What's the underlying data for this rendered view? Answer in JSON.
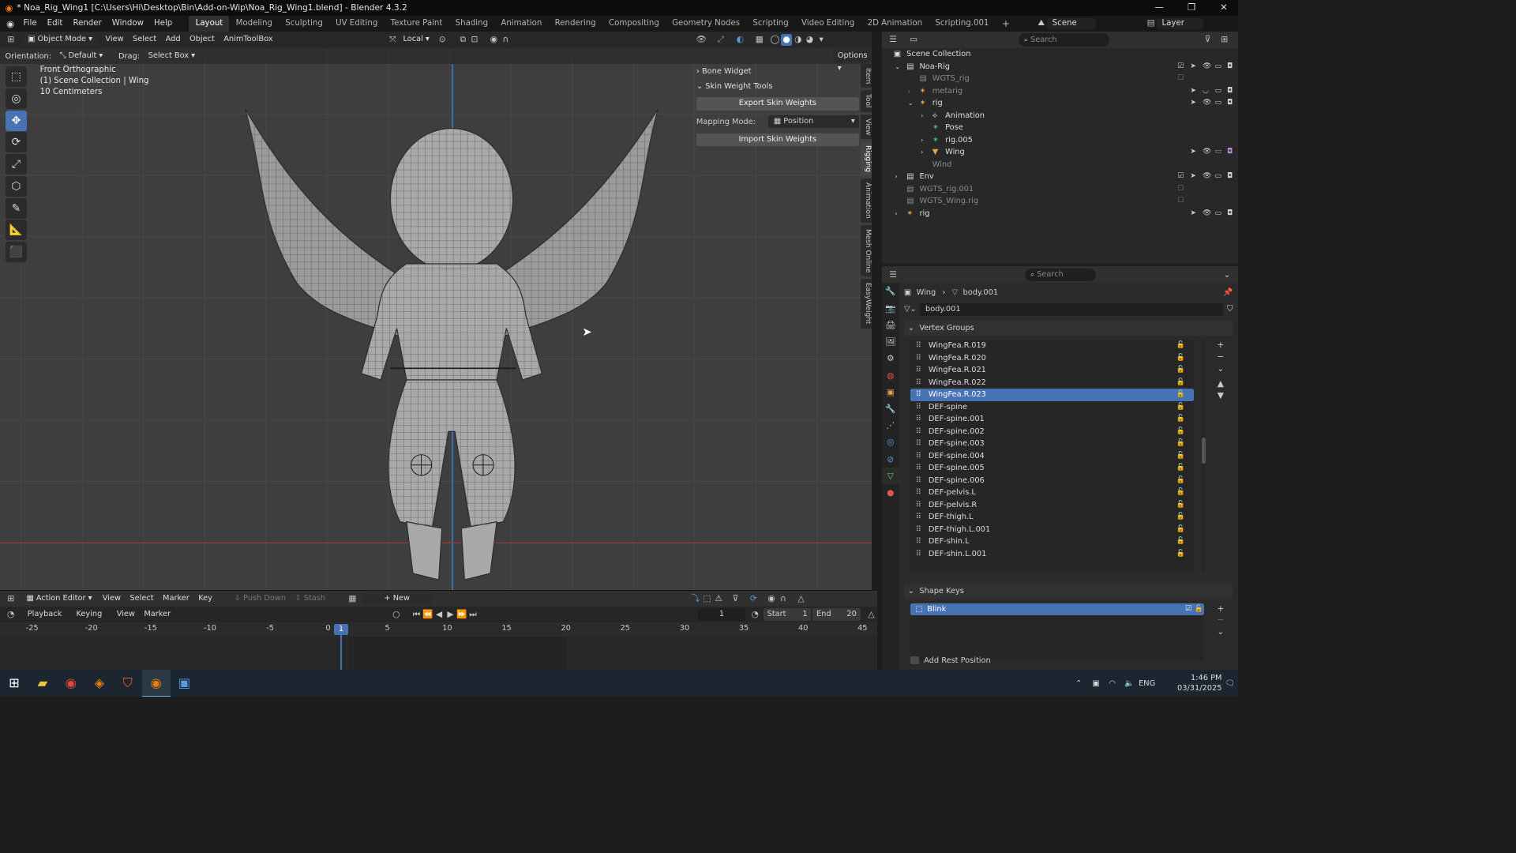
{
  "titlebar": {
    "title": "* Noa_Rig_Wing1 [C:\\Users\\Hi\\Desktop\\Bin\\Add-on-Wip\\Noa_Rig_Wing1.blend] - Blender 4.3.2",
    "minimize": "—",
    "maximize": "❐",
    "close": "✕"
  },
  "menu": {
    "items": [
      "File",
      "Edit",
      "Render",
      "Window",
      "Help"
    ],
    "workspaces": [
      "Layout",
      "Modeling",
      "Sculpting",
      "UV Editing",
      "Texture Paint",
      "Shading",
      "Animation",
      "Rendering",
      "Compositing",
      "Geometry Nodes",
      "Scripting",
      "Video Editing",
      "2D Animation",
      "Scripting.001"
    ],
    "add_tab": "+",
    "scene": "Scene",
    "layer": "Layer"
  },
  "viewport": {
    "mode": "Object Mode",
    "menus": [
      "View",
      "Select",
      "Add",
      "Object",
      "AnimToolBox"
    ],
    "transform_space": "Local",
    "orientation_label": "Orientation:",
    "orientation_value": "Default",
    "drag_label": "Drag:",
    "drag_value": "Select Box",
    "options": "Options",
    "info_line1": "Front Orthographic",
    "info_line2": "(1) Scene Collection | Wing",
    "info_line3": "10 Centimeters",
    "tools": [
      "⬚",
      "◎",
      "✥",
      "⟳",
      "⤢",
      "⬡",
      "✎",
      "📐",
      "⬛"
    ],
    "side_tabs": [
      "Item",
      "Tool",
      "View",
      "Rigging",
      "Animation",
      "Mesh Online",
      "EasyWeight"
    ]
  },
  "npanel": {
    "bone_widget": "Bone Widget",
    "skin_weight_tools": "Skin Weight Tools",
    "export_btn": "Export Skin Weights",
    "mapping_label": "Mapping Mode:",
    "mapping_value": "Position",
    "import_btn": "Import Skin Weights"
  },
  "action_editor": {
    "editor": "Action Editor",
    "menus": [
      "View",
      "Select",
      "Marker",
      "Key"
    ],
    "push_down": "Push Down",
    "stash": "Stash",
    "new": "New",
    "playback": "Playback",
    "keying": "Keying",
    "view": "View",
    "marker": "Marker",
    "current_frame": "1",
    "start_label": "Start",
    "start_value": "1",
    "end_label": "End",
    "end_value": "20",
    "ruler": [
      "-25",
      "-20",
      "-15",
      "-10",
      "-5",
      "0",
      "5",
      "10",
      "15",
      "20",
      "25",
      "30",
      "35",
      "40",
      "45"
    ],
    "playhead_label": "1"
  },
  "outliner": {
    "search_placeholder": "Search",
    "rows": [
      {
        "label": "Scene Collection",
        "indent": 0,
        "icon": "▣"
      },
      {
        "label": "Noa-Rig",
        "indent": 1,
        "icon": "▤"
      },
      {
        "label": "WGTS_rig",
        "indent": 2,
        "icon": "▤",
        "dim": true
      },
      {
        "label": "metarig",
        "indent": 2,
        "icon": "✶",
        "dim": true
      },
      {
        "label": "rig",
        "indent": 2,
        "icon": "✶"
      },
      {
        "label": "Animation",
        "indent": 3,
        "icon": "⟡"
      },
      {
        "label": "Pose",
        "indent": 3,
        "icon": "✶"
      },
      {
        "label": "rig.005",
        "indent": 3,
        "icon": "✶"
      },
      {
        "label": "Wing",
        "indent": 3,
        "icon": "▼"
      },
      {
        "label": "Wind",
        "indent": 2,
        "icon": "",
        "dim": true
      },
      {
        "label": "Env",
        "indent": 1,
        "icon": "▤"
      },
      {
        "label": "WGTS_rig.001",
        "indent": 1,
        "icon": "▤",
        "dim": true
      },
      {
        "label": "WGTS_Wing.rig",
        "indent": 1,
        "icon": "▤",
        "dim": true
      },
      {
        "label": "rig",
        "indent": 1,
        "icon": "✶"
      }
    ]
  },
  "properties": {
    "search_placeholder": "Search",
    "breadcrumb_obj": "Wing",
    "breadcrumb_sep": "›",
    "breadcrumb_data": "body.001",
    "mesh_name": "body.001",
    "vertex_groups_title": "Vertex Groups",
    "vertex_groups": [
      "WingFea.R.019",
      "WingFea.R.020",
      "WingFea.R.021",
      "WingFea.R.022",
      "WingFea.R.023",
      "DEF-spine",
      "DEF-spine.001",
      "DEF-spine.002",
      "DEF-spine.003",
      "DEF-spine.004",
      "DEF-spine.005",
      "DEF-spine.006",
      "DEF-pelvis.L",
      "DEF-pelvis.R",
      "DEF-thigh.L",
      "DEF-thigh.L.001",
      "DEF-shin.L",
      "DEF-shin.L.001"
    ],
    "selected_group": "WingFea.R.023",
    "shape_keys_title": "Shape Keys",
    "shape_key": "Blink",
    "add_rest": "Add Rest Position"
  },
  "taskbar": {
    "lang": "ENG",
    "time": "1:46 PM",
    "date": "03/31/2025"
  }
}
